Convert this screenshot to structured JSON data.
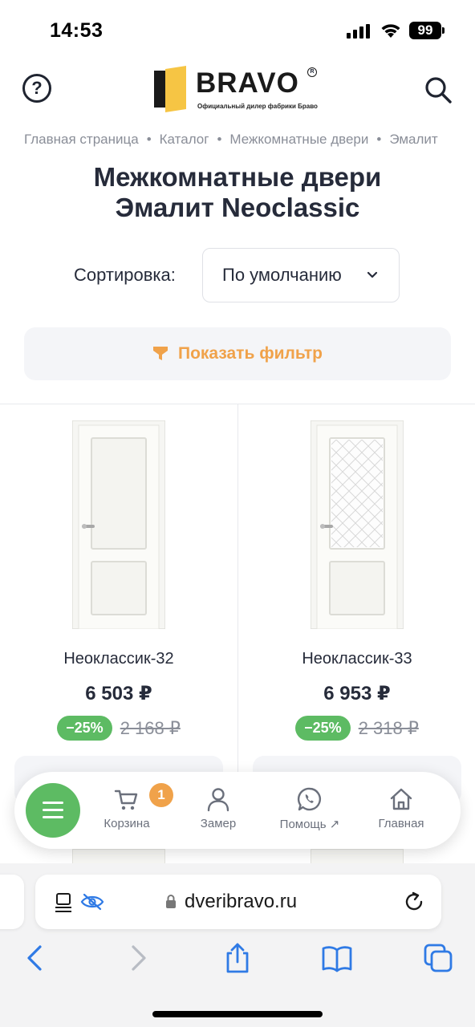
{
  "status_bar": {
    "time": "14:53",
    "battery": "99"
  },
  "header": {
    "help_icon": "question-circle-icon",
    "search_icon": "search-icon",
    "logo": {
      "name": "BRAVO",
      "registered": "R",
      "tagline": "Официальный дилер фабрики Браво"
    }
  },
  "breadcrumb": [
    "Главная страница",
    "Каталог",
    "Межкомнатные двери",
    "Эмалит"
  ],
  "breadcrumb_separator": "•",
  "page": {
    "title_line1": "Межкомнатные двери",
    "title_line2": "Эмалит Neoclassic"
  },
  "sort": {
    "label": "Сортировка:",
    "value": "По умолчанию"
  },
  "filter": {
    "label": "Показать фильтр",
    "icon": "funnel-icon",
    "color": "#f0a24a"
  },
  "products": [
    {
      "name": "Неоклассик-32",
      "price": "6 503 ₽",
      "discount": "−25%",
      "old_price": "2 168 ₽"
    },
    {
      "name": "Неоклассик-33",
      "price": "6 953 ₽",
      "discount": "−25%",
      "old_price": "2 318 ₽"
    }
  ],
  "tabbar": {
    "menu_icon": "hamburger-icon",
    "cart_badge": "1",
    "tabs": [
      {
        "label": "Корзина",
        "icon": "cart-icon"
      },
      {
        "label": "Замер",
        "icon": "user-icon"
      },
      {
        "label": "Помощь ↗",
        "icon": "whatsapp-icon"
      },
      {
        "label": "Главная",
        "icon": "home-icon"
      }
    ]
  },
  "browser": {
    "url": "dveribravo.ru"
  },
  "colors": {
    "accent_green": "#5dbb63",
    "accent_orange": "#f0a24a",
    "text_dark": "#262b3a"
  }
}
